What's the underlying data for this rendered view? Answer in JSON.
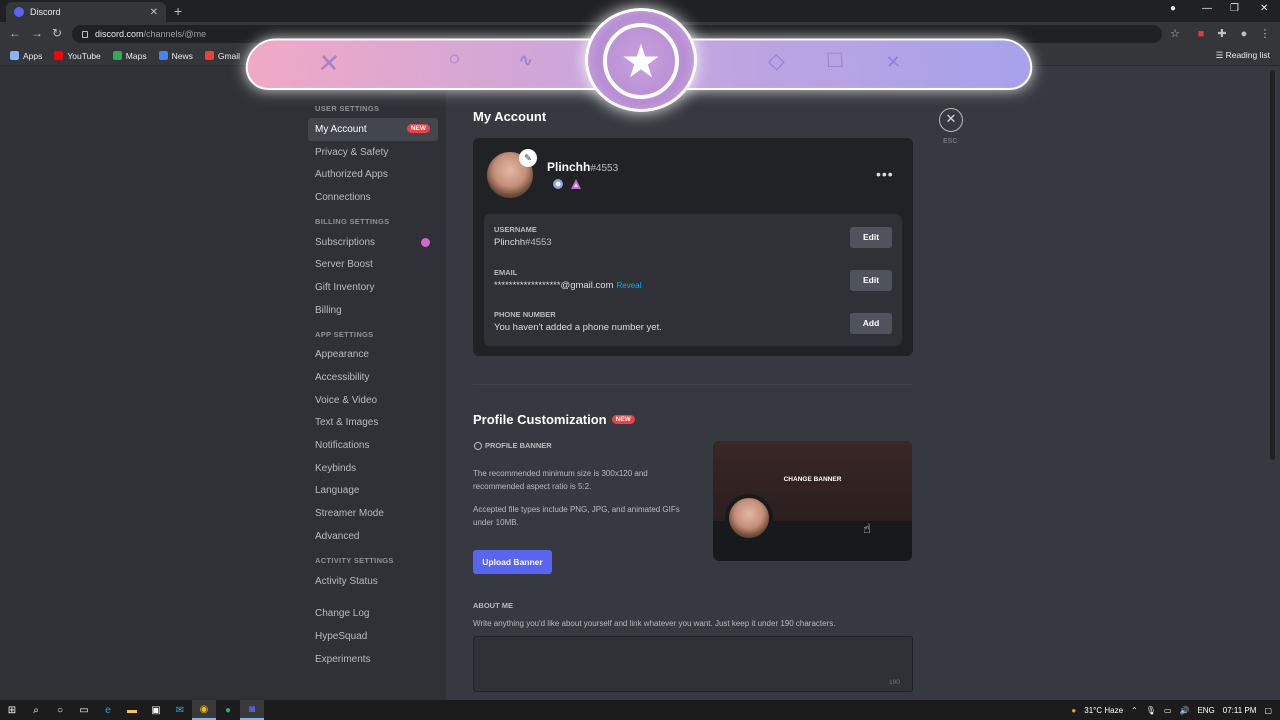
{
  "browser": {
    "tab_title": "Discord",
    "url_host": "discord.com",
    "url_path": "/channels/@me",
    "bookmarks": [
      "Apps",
      "YouTube",
      "Maps",
      "News",
      "Gmail"
    ],
    "reading_list": "Reading list"
  },
  "sidebar": {
    "sections": [
      {
        "header": "USER SETTINGS",
        "items": [
          "My Account",
          "Privacy & Safety",
          "Authorized Apps",
          "Connections"
        ]
      },
      {
        "header": "BILLING SETTINGS",
        "items": [
          "Subscriptions",
          "Server Boost",
          "Gift Inventory",
          "Billing"
        ]
      },
      {
        "header": "APP SETTINGS",
        "items": [
          "Appearance",
          "Accessibility",
          "Voice & Video",
          "Text & Images",
          "Notifications",
          "Keybinds",
          "Language",
          "Streamer Mode",
          "Advanced"
        ]
      },
      {
        "header": "ACTIVITY SETTINGS",
        "items": [
          "Activity Status"
        ]
      }
    ],
    "extra_items": [
      "Change Log",
      "HypeSquad",
      "Experiments"
    ],
    "active_item": "My Account",
    "new_badge": "NEW"
  },
  "account": {
    "title": "My Account",
    "esc": "ESC",
    "username": "Plinchh",
    "discriminator": "#4553",
    "fields": [
      {
        "label": "USERNAME",
        "value": "Plinchh",
        "tag": "#4553",
        "button": "Edit"
      },
      {
        "label": "EMAIL",
        "value": "******************@gmail.com",
        "reveal": "Reveal",
        "button": "Edit"
      },
      {
        "label": "PHONE NUMBER",
        "value": "You haven't added a phone number yet.",
        "button": "Add"
      }
    ]
  },
  "profile": {
    "title": "Profile Customization",
    "new_badge": "NEW",
    "banner_label": "PROFILE BANNER",
    "desc1": "The recommended minimum size is 300x120 and recommended aspect ratio is 5:2.",
    "desc2": "Accepted file types include PNG, JPG, and animated GIFs under 10MB.",
    "upload_button": "Upload Banner",
    "change_banner": "CHANGE BANNER",
    "about_label": "ABOUT ME",
    "about_desc": "Write anything you'd like about yourself and link whatever you want. Just keep it under 190 characters.",
    "about_count": "190"
  },
  "taskbar": {
    "weather": "31°C  Haze",
    "lang": "ENG",
    "time": "07:11 PM"
  },
  "colors": {
    "blurple": "#5865f2",
    "new_red": "#ed4245",
    "link": "#00b0f4"
  }
}
